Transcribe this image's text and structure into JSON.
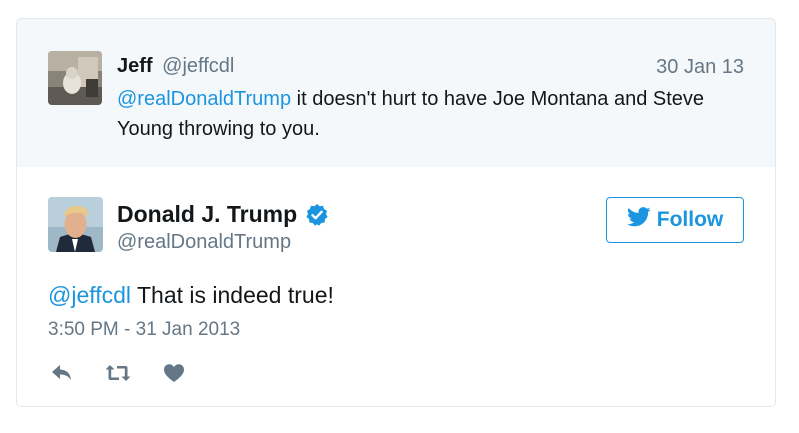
{
  "parent_tweet": {
    "author_name": "Jeff",
    "author_handle": "@jeffcdl",
    "date": "30 Jan 13",
    "mention": "@realDonaldTrump",
    "text": " it doesn't hurt to have Joe Montana and Steve Young throwing to you."
  },
  "main_tweet": {
    "author_name": "Donald J. Trump",
    "author_handle": "@realDonaldTrump",
    "verified": true,
    "follow_label": "Follow",
    "mention": "@jeffcdl",
    "text": " That is indeed true!",
    "timestamp": "3:50 PM - 31 Jan 2013"
  },
  "icons": {
    "follow": "twitter-bird-icon",
    "verified": "verified-badge-icon",
    "reply": "reply-icon",
    "retweet": "retweet-icon",
    "like": "heart-icon"
  },
  "colors": {
    "link": "#1b95e0",
    "secondary_text": "#657786",
    "parent_background": "#f5f8fa",
    "action_icon": "#657786"
  }
}
